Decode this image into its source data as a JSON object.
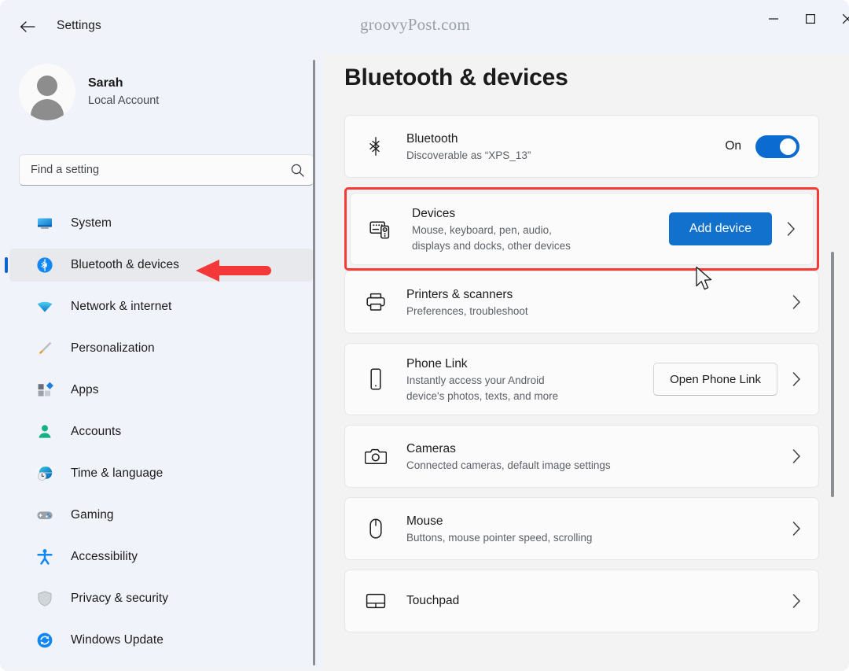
{
  "window": {
    "title": "Settings",
    "watermark": "groovyPost.com",
    "controls": {
      "minimize": "Minimize",
      "maximize": "Maximize",
      "close": "Close"
    },
    "back": "Back"
  },
  "sidebar": {
    "account": {
      "name": "Sarah",
      "type": "Local Account"
    },
    "search": {
      "placeholder": "Find a setting",
      "value": "",
      "icon": "search-icon"
    },
    "items": [
      {
        "label": "System",
        "icon": "monitor-icon",
        "selected": false
      },
      {
        "label": "Bluetooth & devices",
        "icon": "bluetooth-icon",
        "selected": true
      },
      {
        "label": "Network & internet",
        "icon": "wifi-icon",
        "selected": false
      },
      {
        "label": "Personalization",
        "icon": "paintbrush-icon",
        "selected": false
      },
      {
        "label": "Apps",
        "icon": "apps-icon",
        "selected": false
      },
      {
        "label": "Accounts",
        "icon": "person-icon",
        "selected": false
      },
      {
        "label": "Time & language",
        "icon": "clock-globe-icon",
        "selected": false
      },
      {
        "label": "Gaming",
        "icon": "gamepad-icon",
        "selected": false
      },
      {
        "label": "Accessibility",
        "icon": "accessibility-icon",
        "selected": false
      },
      {
        "label": "Privacy & security",
        "icon": "shield-icon",
        "selected": false
      },
      {
        "label": "Windows Update",
        "icon": "update-icon",
        "selected": false
      }
    ]
  },
  "main": {
    "page_title": "Bluetooth & devices",
    "bluetooth": {
      "title": "Bluetooth",
      "subtitle": "Discoverable as “XPS_13”",
      "toggle_state": "On",
      "toggle_on": true,
      "icon": "bluetooth-icon"
    },
    "devices": {
      "title": "Devices",
      "subtitle_line1": "Mouse, keyboard, pen, audio,",
      "subtitle_line2": "displays and docks, other devices",
      "button": "Add device",
      "icon": "keyboard-device-icon",
      "highlighted": true
    },
    "printers": {
      "title": "Printers & scanners",
      "subtitle": "Preferences, troubleshoot",
      "icon": "printer-icon"
    },
    "phone_link": {
      "title": "Phone Link",
      "subtitle_line1": "Instantly access your Android",
      "subtitle_line2": "device's photos, texts, and more",
      "button": "Open Phone Link",
      "icon": "phone-icon"
    },
    "cameras": {
      "title": "Cameras",
      "subtitle": "Connected cameras, default image settings",
      "icon": "camera-icon"
    },
    "mouse": {
      "title": "Mouse",
      "subtitle": "Buttons, mouse pointer speed, scrolling",
      "icon": "mouse-icon"
    },
    "touchpad": {
      "title": "Touchpad",
      "subtitle": "",
      "icon": "touchpad-icon"
    }
  },
  "annotations": {
    "arrow_color": "#f4383a",
    "highlight_color": "#f63a35",
    "accent_color": "#0c6bd0"
  }
}
